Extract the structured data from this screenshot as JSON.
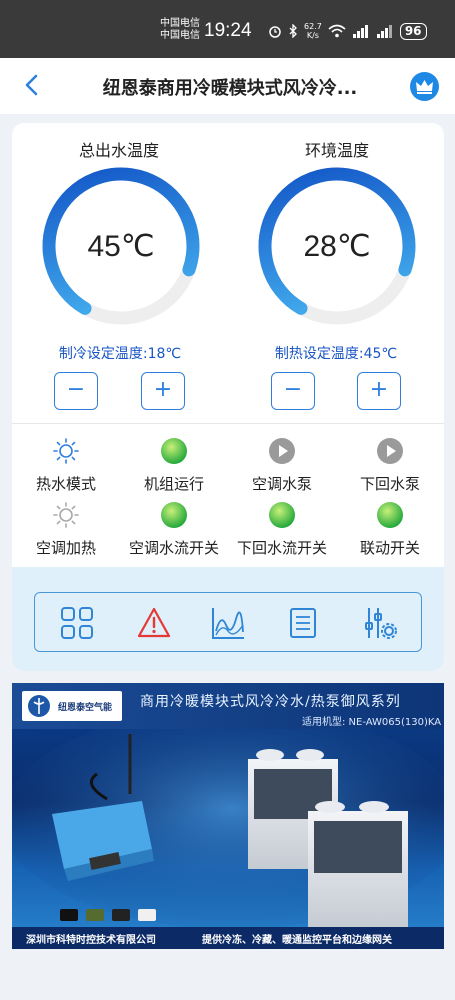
{
  "status_bar": {
    "carrier1": "中国电信",
    "carrier2": "中国电信",
    "time": "19:24",
    "net_speed": "62.7",
    "net_unit": "K/s",
    "battery": "96"
  },
  "header": {
    "title": "纽恩泰商用冷暖模块式风冷冷..."
  },
  "gauges": [
    {
      "title": "总出水温度",
      "value": "45℃",
      "setpoint": "制冷设定温度:18℃",
      "fill_fraction": 0.72
    },
    {
      "title": "环境温度",
      "value": "28℃",
      "setpoint": "制热设定温度:45℃",
      "fill_fraction": 0.72
    }
  ],
  "steppers": {
    "minus": "−",
    "plus": "+"
  },
  "status_items": [
    {
      "label": "热水模式",
      "icon": "sun-icon",
      "state": "on"
    },
    {
      "label": "机组运行",
      "icon": "green-dot-icon",
      "state": "on"
    },
    {
      "label": "空调水泵",
      "icon": "play-icon",
      "state": "off"
    },
    {
      "label": "下回水泵",
      "icon": "play-icon",
      "state": "off"
    },
    {
      "label": "空调加热",
      "icon": "sun-icon",
      "state": "off"
    },
    {
      "label": "空调水流开关",
      "icon": "green-dot-icon",
      "state": "on"
    },
    {
      "label": "下回水流开关",
      "icon": "green-dot-icon",
      "state": "on"
    },
    {
      "label": "联动开关",
      "icon": "green-dot-icon",
      "state": "on"
    }
  ],
  "toolbar": [
    "grid-icon",
    "alarm-icon",
    "chart-icon",
    "list-icon",
    "settings-sliders-icon"
  ],
  "banner": {
    "logo_text": "纽恩泰空气能",
    "headline": "商用冷暖模块式风冷冷水/热泵御风系列",
    "model": "适用机型: NE-AW065(130)KA",
    "company": "深圳市科特时控技术有限公司",
    "slogan": "提供冷冻、冷藏、暖通监控平台和边缘网关"
  },
  "colors": {
    "accent": "#2f7fde",
    "setpoint_text": "#1a56c4",
    "gauge_start": "#0f4fc4",
    "gauge_end": "#4fc3f7",
    "on_green": "#3cc63c",
    "alarm_red": "#e53935"
  }
}
